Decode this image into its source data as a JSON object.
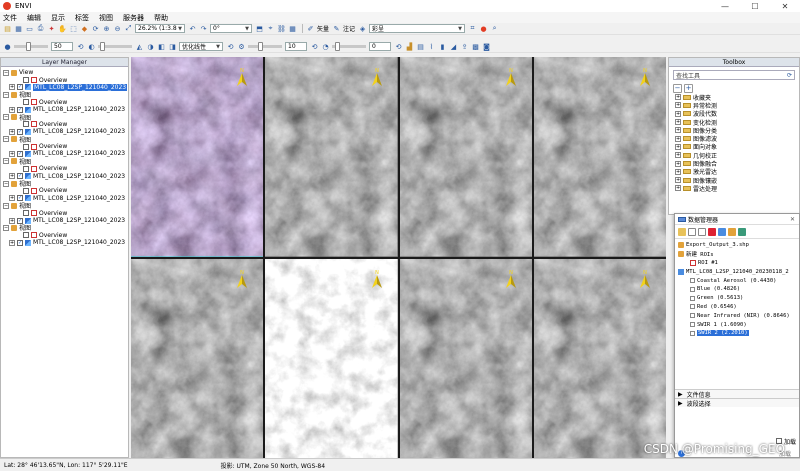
{
  "window": {
    "title": "ENVI",
    "controls": [
      "—",
      "☐",
      "✕"
    ]
  },
  "menu": [
    "文件",
    "编辑",
    "显示",
    "标签",
    "视图",
    "服务器",
    "帮助"
  ],
  "toolbar": {
    "zoom_value": "26.2% (1:3.8",
    "rotation_value": "0°",
    "vector_label": "矢量",
    "annotation_label": "注记",
    "projection_value": "彩呈",
    "stretch_value": "优化线性",
    "opacity_value": "50",
    "brightness_value": "10",
    "sharpen_value": "0"
  },
  "layer_manager": {
    "title": "Layer Manager",
    "rows": [
      {
        "indent": 0,
        "type": "view",
        "label": "View",
        "expander": "−"
      },
      {
        "indent": 2,
        "type": "overview",
        "label": "Overview",
        "expander": ""
      },
      {
        "indent": 1,
        "type": "raster",
        "label": "MTL_LC08_L2SP_121040_2023",
        "expander": "+",
        "selected": true
      },
      {
        "indent": 0,
        "type": "view",
        "label": "视图",
        "expander": "−"
      },
      {
        "indent": 2,
        "type": "overview",
        "label": "Overview",
        "expander": ""
      },
      {
        "indent": 1,
        "type": "raster",
        "label": "MTL_LC08_L2SP_121040_2023",
        "expander": "+"
      },
      {
        "indent": 0,
        "type": "view",
        "label": "视图",
        "expander": "−"
      },
      {
        "indent": 2,
        "type": "overview",
        "label": "Overview",
        "expander": ""
      },
      {
        "indent": 1,
        "type": "raster",
        "label": "MTL_LC08_L2SP_121040_2023",
        "expander": "+"
      },
      {
        "indent": 0,
        "type": "view",
        "label": "视图",
        "expander": "−"
      },
      {
        "indent": 2,
        "type": "overview",
        "label": "Overview",
        "expander": ""
      },
      {
        "indent": 1,
        "type": "raster",
        "label": "MTL_LC08_L2SP_121040_2023",
        "expander": "+"
      },
      {
        "indent": 0,
        "type": "view",
        "label": "视图",
        "expander": "−"
      },
      {
        "indent": 2,
        "type": "overview",
        "label": "Overview",
        "expander": ""
      },
      {
        "indent": 1,
        "type": "raster",
        "label": "MTL_LC08_L2SP_121040_2023",
        "expander": "+"
      },
      {
        "indent": 0,
        "type": "view",
        "label": "视图",
        "expander": "−"
      },
      {
        "indent": 2,
        "type": "overview",
        "label": "Overview",
        "expander": ""
      },
      {
        "indent": 1,
        "type": "raster",
        "label": "MTL_LC08_L2SP_121040_2023",
        "expander": "+"
      },
      {
        "indent": 0,
        "type": "view",
        "label": "视图",
        "expander": "−"
      },
      {
        "indent": 2,
        "type": "overview",
        "label": "Overview",
        "expander": ""
      },
      {
        "indent": 1,
        "type": "raster",
        "label": "MTL_LC08_L2SP_121040_2023",
        "expander": "+"
      },
      {
        "indent": 0,
        "type": "view",
        "label": "视图",
        "expander": "−"
      },
      {
        "indent": 2,
        "type": "overview",
        "label": "Overview",
        "expander": ""
      },
      {
        "indent": 1,
        "type": "raster",
        "label": "MTL_LC08_L2SP_121040_2023",
        "expander": "+"
      }
    ]
  },
  "image_views": {
    "north_label": "N",
    "tiles": [
      {
        "row": 0,
        "col": 0,
        "active": true,
        "tint": "#6a6870",
        "style": "color"
      },
      {
        "row": 0,
        "col": 1,
        "active": false,
        "tint": "#555555",
        "style": "gray"
      },
      {
        "row": 0,
        "col": 2,
        "active": false,
        "tint": "#5c5c5c",
        "style": "gray"
      },
      {
        "row": 0,
        "col": 3,
        "active": false,
        "tint": "#585858",
        "style": "gray"
      },
      {
        "row": 1,
        "col": 0,
        "active": false,
        "tint": "#5a5a5a",
        "style": "gray"
      },
      {
        "row": 1,
        "col": 1,
        "active": false,
        "tint": "#9a9a9a",
        "style": "light"
      },
      {
        "row": 1,
        "col": 2,
        "active": false,
        "tint": "#505050",
        "style": "gray"
      },
      {
        "row": 1,
        "col": 3,
        "active": false,
        "tint": "#565656",
        "style": "gray"
      }
    ]
  },
  "toolbox": {
    "title": "Toolbox",
    "search_placeholder": "查找工具",
    "items": [
      "收藏夹",
      "异常检测",
      "波段代数",
      "变化检测",
      "图像分类",
      "图像滤波",
      "面向对象",
      "几何校正",
      "图像融合",
      "激光雷达",
      "图像镶嵌",
      "雷达处理"
    ]
  },
  "data_manager": {
    "title": "数据管理器",
    "rows": [
      {
        "indent": 0,
        "label": "Export_Output_3.shp",
        "kind": "file"
      },
      {
        "indent": 0,
        "label": "新建 ROIs",
        "kind": "group"
      },
      {
        "indent": 2,
        "label": "ROI #1",
        "kind": "roi"
      },
      {
        "indent": 0,
        "label": "MTL_LC08_L2SP_121040_20230118_2",
        "kind": "raster"
      },
      {
        "indent": 2,
        "label": "Coastal Aerosol (0.4430)",
        "kind": "band",
        "color": "#ffffff"
      },
      {
        "indent": 2,
        "label": "Blue (0.4826)",
        "kind": "band",
        "color": "#ffffff"
      },
      {
        "indent": 2,
        "label": "Green (0.5613)",
        "kind": "band",
        "color": "#ffffff"
      },
      {
        "indent": 2,
        "label": "Red (0.6546)",
        "kind": "band",
        "color": "#ffffff"
      },
      {
        "indent": 2,
        "label": "Near Infrared (NIR) (0.8646)",
        "kind": "band",
        "color": "#ffffff"
      },
      {
        "indent": 2,
        "label": "SWIR 1 (1.6090)",
        "kind": "band",
        "color": "#ffffff"
      },
      {
        "indent": 2,
        "label": "SWIR 2 (2.2010)",
        "kind": "band",
        "color": "#ffffff",
        "selected": true
      }
    ],
    "sections": [
      "文件信息",
      "波段选择"
    ],
    "load_checkbox": "加载",
    "load_button": "加载"
  },
  "status": {
    "coords": "Lat: 28° 46'13.65\"N, Lon: 117° 5'29.11\"E",
    "projection": "投影: UTM, Zone 50 North, WGS-84"
  },
  "watermark": "CSDN @Promising_GEO"
}
